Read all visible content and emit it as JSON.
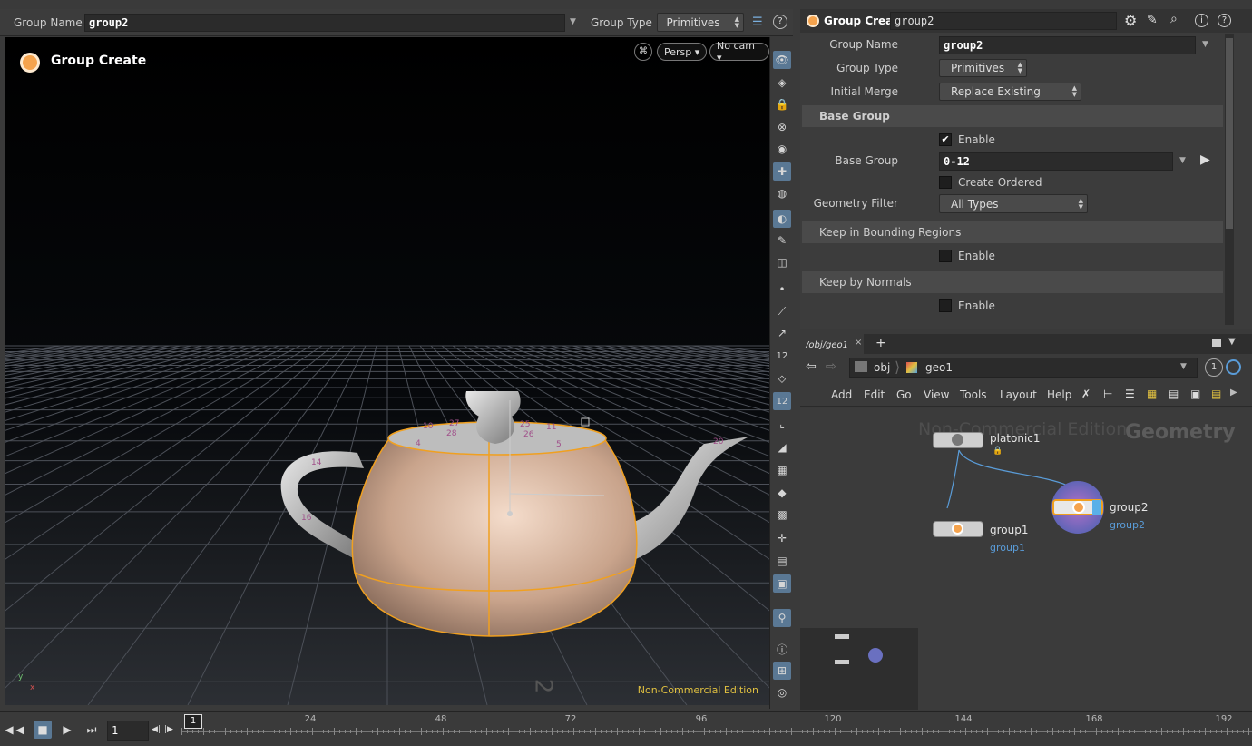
{
  "toolbar": {
    "group_name_label": "Group Name",
    "group_name_value": "group2",
    "group_type_label": "Group Type",
    "group_type_value": "Primitives"
  },
  "viewport": {
    "title": "Group Create",
    "persp": "Persp ▾",
    "cam": "No cam ▾",
    "watermark": "Non-Commercial Edition",
    "axis_y": "y",
    "axis_x": "x",
    "point_numbers": [
      "10",
      "27",
      "28",
      "4",
      "25",
      "26",
      "11",
      "5",
      "14",
      "16",
      "20",
      "2"
    ]
  },
  "params": {
    "node_type": "Group Create",
    "node_name": "group2",
    "group_name_label": "Group Name",
    "group_name": "group2",
    "group_type_label": "Group Type",
    "group_type": "Primitives",
    "initial_merge_label": "Initial Merge",
    "initial_merge": "Replace Existing",
    "base_group_section": "Base Group",
    "enable_label": "Enable",
    "enable_checked": "✔",
    "base_group_label": "Base Group",
    "base_group_value": "0-12",
    "create_ordered_label": "Create Ordered",
    "geometry_filter_label": "Geometry Filter",
    "geometry_filter": "All Types",
    "bounding_section": "Keep in Bounding Regions",
    "bounding_enable": "Enable",
    "normals_section": "Keep by Normals",
    "normals_enable": "Enable"
  },
  "network": {
    "tab": "/obj/geo1",
    "add_tab": "+",
    "path_obj": "obj",
    "path_geo": "geo1",
    "badge": "1",
    "menu": [
      "Add",
      "Edit",
      "Go",
      "View",
      "Tools",
      "Layout",
      "Help"
    ],
    "bg_watermark": "Non-Commercial Edition",
    "bg_context": "Geometry",
    "nodes": [
      {
        "name": "platonic1",
        "sub": ""
      },
      {
        "name": "group1",
        "sub": "group1"
      },
      {
        "name": "group2",
        "sub": "group2"
      }
    ]
  },
  "timeline": {
    "frame": "1",
    "current_marker": "1",
    "ticks": [
      "24",
      "48",
      "72",
      "96",
      "120",
      "144",
      "168",
      "192"
    ]
  },
  "colors": {
    "accent": "#5a7894",
    "selection": "#f0a020",
    "node_sub": "#5a9cd8",
    "watermark": "#e0c040"
  }
}
